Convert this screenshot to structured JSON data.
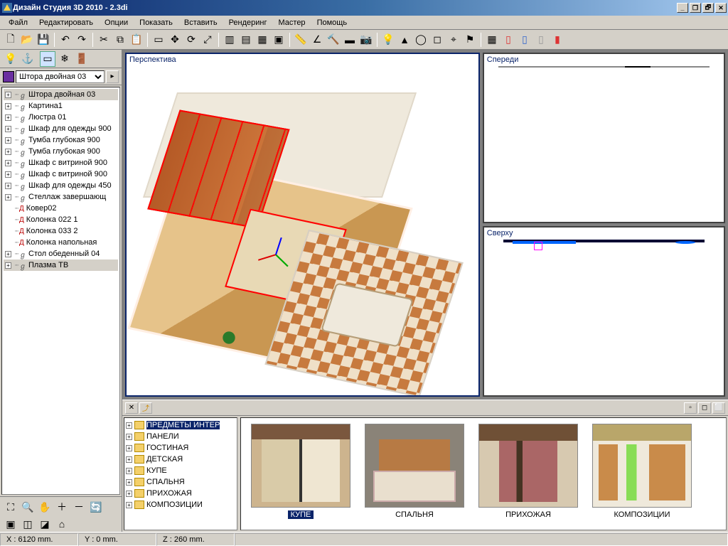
{
  "title": "Дизайн Студия 3D 2010 - 2.3di",
  "menu": [
    "Файл",
    "Редактировать",
    "Опции",
    "Показать",
    "Вставить",
    "Рендеринг",
    "Мастер",
    "Помощь"
  ],
  "objSelect": {
    "selected": "Штора двойная 03"
  },
  "tree": [
    {
      "exp": "+",
      "ico": "G",
      "label": "Штора двойная 03",
      "sel": true
    },
    {
      "exp": "+",
      "ico": "G",
      "label": "Картина1"
    },
    {
      "exp": "+",
      "ico": "G",
      "label": "Люстра 01"
    },
    {
      "exp": "+",
      "ico": "G",
      "label": "Шкаф для одежды 900"
    },
    {
      "exp": "+",
      "ico": "G",
      "label": "Тумба глубокая 900"
    },
    {
      "exp": "+",
      "ico": "G",
      "label": "Тумба глубокая 900"
    },
    {
      "exp": "+",
      "ico": "G",
      "label": "Шкаф с витриной 900"
    },
    {
      "exp": "+",
      "ico": "G",
      "label": "Шкаф с витриной 900"
    },
    {
      "exp": "+",
      "ico": "G",
      "label": "Шкаф для одежды 450"
    },
    {
      "exp": "+",
      "ico": "G",
      "label": "Стеллаж завершающ"
    },
    {
      "exp": "",
      "ico": "D",
      "label": "Ковер02"
    },
    {
      "exp": "",
      "ico": "D",
      "label": "Колонка 022 1"
    },
    {
      "exp": "",
      "ico": "D",
      "label": "Колонка 033 2"
    },
    {
      "exp": "",
      "ico": "D",
      "label": "Колонка напольная"
    },
    {
      "exp": "+",
      "ico": "G",
      "label": "Стол обеденный 04"
    },
    {
      "exp": "+",
      "ico": "G",
      "label": "Плазма ТВ",
      "sel2": true
    }
  ],
  "viewports": {
    "perspective": "Перспектива",
    "front": "Спереди",
    "top": "Сверху"
  },
  "categories": [
    {
      "label": "ПРЕДМЕТЫ ИНТЕР",
      "sel": true
    },
    {
      "label": "ПАНЕЛИ"
    },
    {
      "label": "ГОСТИНАЯ"
    },
    {
      "label": "ДЕТСКАЯ"
    },
    {
      "label": "КУПЕ"
    },
    {
      "label": "СПАЛЬНЯ"
    },
    {
      "label": "ПРИХОЖАЯ"
    },
    {
      "label": "КОМПОЗИЦИИ"
    }
  ],
  "thumbs": [
    {
      "id": "kupe",
      "label": "КУПЕ"
    },
    {
      "id": "spalnya",
      "label": "СПАЛЬНЯ"
    },
    {
      "id": "prih",
      "label": "ПРИХОЖАЯ"
    },
    {
      "id": "komp",
      "label": "КОМПОЗИЦИИ"
    }
  ],
  "status": {
    "x": "X : 6120 mm.",
    "y": "Y : 0 mm.",
    "z": "Z : 260 mm."
  }
}
